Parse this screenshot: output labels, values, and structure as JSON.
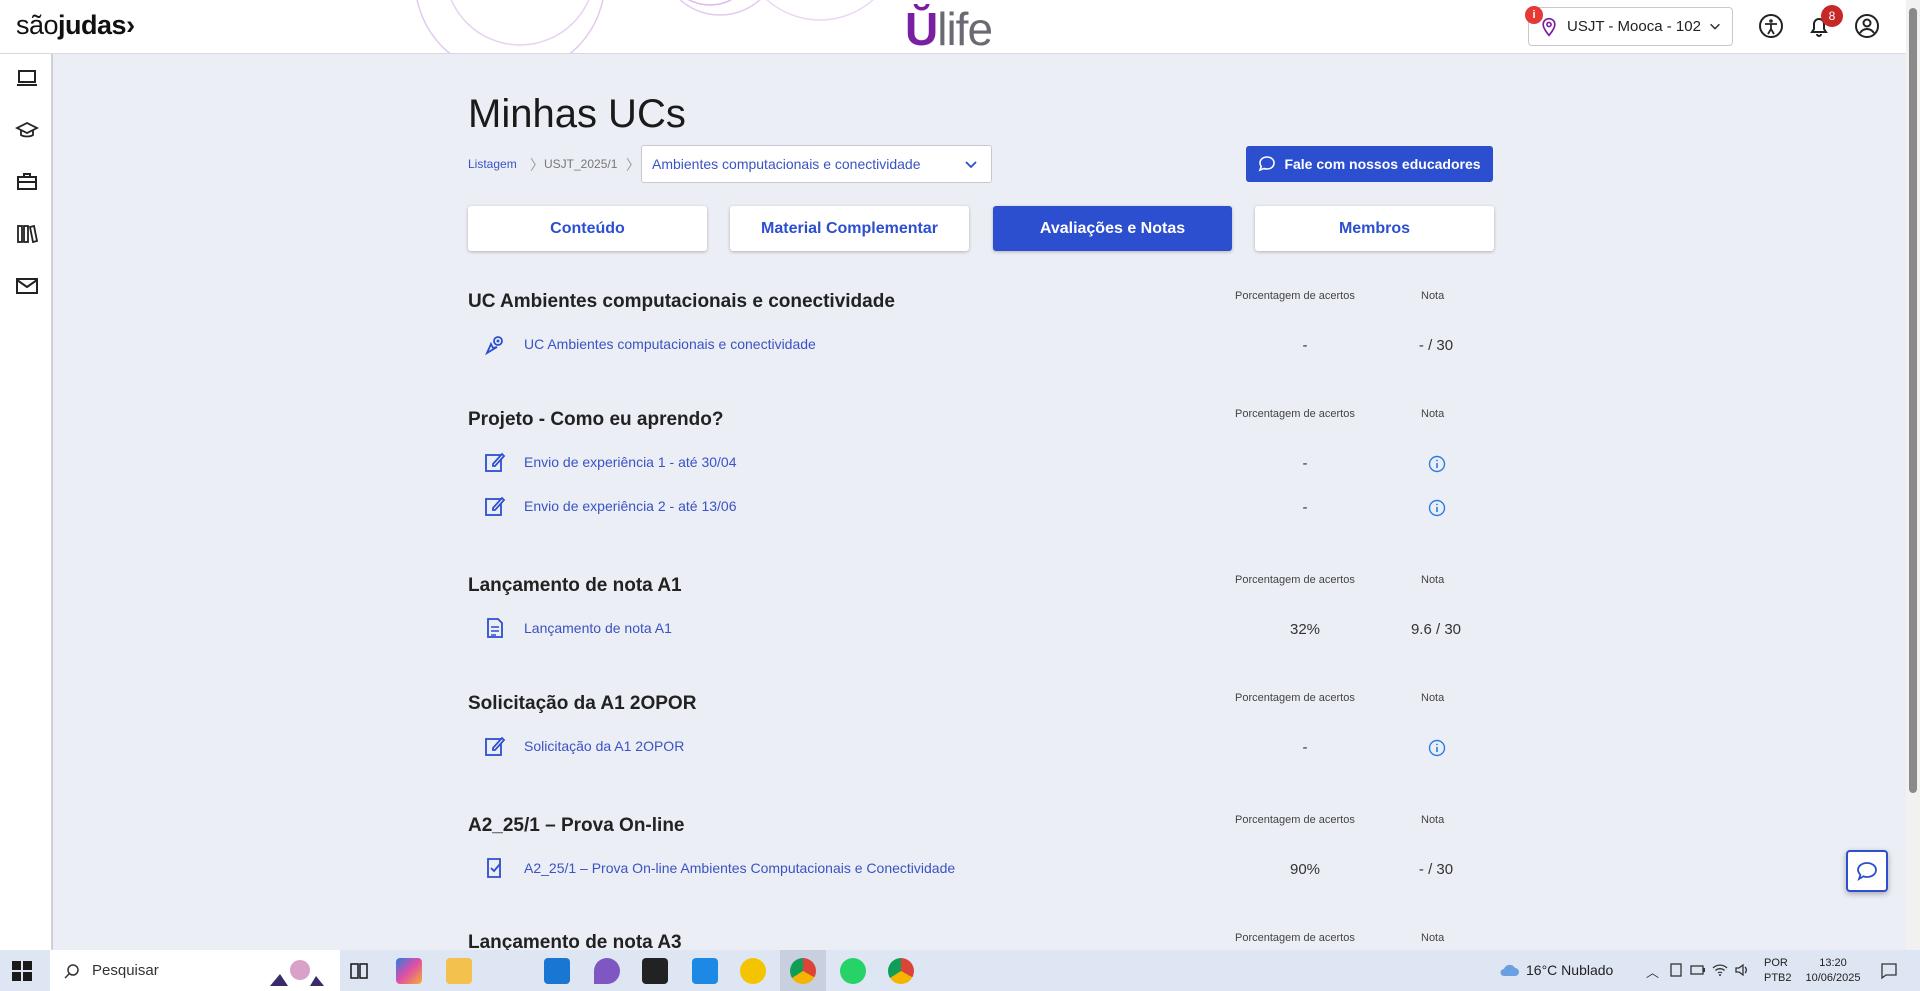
{
  "header": {
    "brand_prefix": "são",
    "brand_suffix": "judas",
    "product_logo": "ulife",
    "campus": "USJT - Mooca - 102",
    "campus_alert": "i",
    "notifications_count": "8",
    "icons": [
      "accessibility-icon",
      "bell-icon",
      "user-account-icon"
    ]
  },
  "sidebar": {
    "items": [
      "laptop-icon",
      "graduation-cap-icon",
      "briefcase-icon",
      "library-icon",
      "mail-icon"
    ]
  },
  "page": {
    "title": "Minhas UCs",
    "breadcrumb": [
      "Listagem",
      "USJT_2025/1"
    ],
    "uc_select": "Ambientes computacionais e conectividade",
    "contact_button": "Fale com nossos educadores"
  },
  "tabs": [
    {
      "label": "Conteúdo",
      "active": false
    },
    {
      "label": "Material Complementar",
      "active": false
    },
    {
      "label": "Avaliações e Notas",
      "active": true
    },
    {
      "label": "Membros",
      "active": false
    }
  ],
  "columns": {
    "pct": "Porcentagem de acertos",
    "grade": "Nota"
  },
  "sections": [
    {
      "title": "UC Ambientes computacionais e conectividade",
      "items": [
        {
          "icon": "link-cursor-icon",
          "label": "UC Ambientes computacionais e conectividade",
          "pct": "-",
          "grade": "- / 30"
        }
      ]
    },
    {
      "title": "Projeto - Como eu aprendo?",
      "items": [
        {
          "icon": "edit-icon",
          "label": "Envio de experiência 1 - até 30/04",
          "pct": "-",
          "grade": ""
        },
        {
          "icon": "edit-icon",
          "label": "Envio de experiência 2 - até 13/06",
          "pct": "-",
          "grade": ""
        }
      ]
    },
    {
      "title": "Lançamento de nota A1",
      "items": [
        {
          "icon": "grade-sheet-icon",
          "label": "Lançamento de nota A1",
          "pct": "32%",
          "grade": "9.6 / 30"
        }
      ]
    },
    {
      "title": "Solicitação da A1 2OPOR",
      "items": [
        {
          "icon": "edit-icon",
          "label": "Solicitação da A1 2OPOR",
          "pct": "-",
          "grade": ""
        }
      ]
    },
    {
      "title": "A2_25/1 – Prova On-line",
      "items": [
        {
          "icon": "exam-icon",
          "label": "A2_25/1 – Prova On-line Ambientes Computacionais e Conectividade",
          "pct": "90%",
          "grade": "- / 30"
        }
      ]
    },
    {
      "title": "Lançamento de nota A3",
      "items": []
    }
  ],
  "taskbar": {
    "search_placeholder": "Pesquisar",
    "weather": "16°C  Nublado",
    "lang_1": "POR",
    "lang_2": "PTB2",
    "time": "13:20",
    "date": "10/06/2025"
  },
  "colors": {
    "accent": "#2c4fcf",
    "link": "#3a53c4",
    "brand_purple": "#7b1fa2"
  }
}
